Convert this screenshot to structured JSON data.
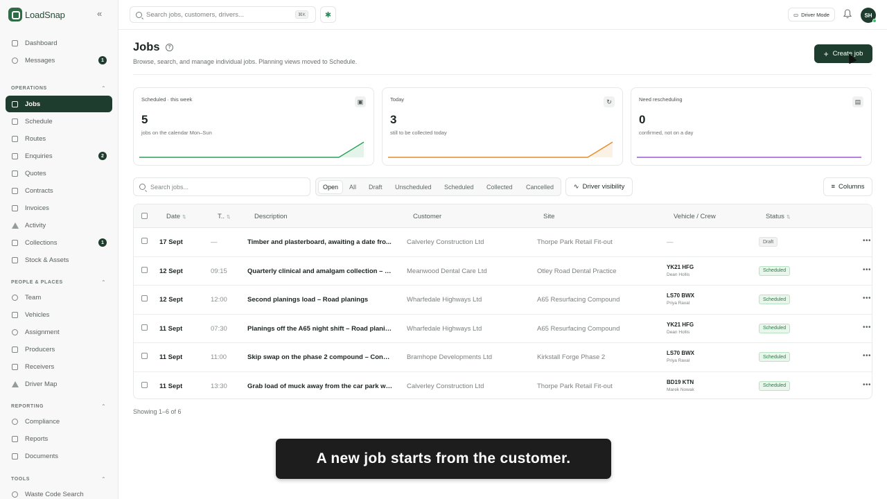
{
  "app": {
    "name": "LoadSnap",
    "collapse_glyph": "«"
  },
  "sidebar": {
    "top_items": [
      {
        "label": "Dashboard",
        "icon": "dashboard-icon"
      },
      {
        "label": "Messages",
        "icon": "message-icon",
        "badge": "1"
      }
    ],
    "sections": [
      {
        "title": "OPERATIONS",
        "items": [
          {
            "label": "Jobs",
            "icon": "clipboard-icon",
            "active": true
          },
          {
            "label": "Schedule",
            "icon": "calendar-icon"
          },
          {
            "label": "Routes",
            "icon": "route-icon"
          },
          {
            "label": "Enquiries",
            "icon": "document-icon",
            "badge": "2"
          },
          {
            "label": "Quotes",
            "icon": "quote-icon"
          },
          {
            "label": "Contracts",
            "icon": "contract-icon"
          },
          {
            "label": "Invoices",
            "icon": "invoice-icon"
          },
          {
            "label": "Activity",
            "icon": "activity-icon"
          },
          {
            "label": "Collections",
            "icon": "collections-icon",
            "badge": "1"
          },
          {
            "label": "Stock & Assets",
            "icon": "box-icon"
          }
        ]
      },
      {
        "title": "PEOPLE & PLACES",
        "items": [
          {
            "label": "Team",
            "icon": "team-icon"
          },
          {
            "label": "Vehicles",
            "icon": "truck-icon"
          },
          {
            "label": "Assignment",
            "icon": "link-icon"
          },
          {
            "label": "Producers",
            "icon": "producer-icon"
          },
          {
            "label": "Receivers",
            "icon": "download-icon"
          },
          {
            "label": "Driver Map",
            "icon": "navigation-icon"
          }
        ]
      },
      {
        "title": "REPORTING",
        "items": [
          {
            "label": "Compliance",
            "icon": "shield-icon"
          },
          {
            "label": "Reports",
            "icon": "bar-chart-icon"
          },
          {
            "label": "Documents",
            "icon": "file-icon"
          }
        ]
      },
      {
        "title": "TOOLS",
        "items": [
          {
            "label": "Waste Code Search",
            "icon": "search-icon"
          }
        ]
      }
    ]
  },
  "topbar": {
    "search_placeholder": "Search jobs, customers, drivers...",
    "search_shortcut": "⌘K",
    "driver_mode_label": "Driver Mode",
    "avatar_initials": "SH"
  },
  "page": {
    "title": "Jobs",
    "help_glyph": "?",
    "subtitle": "Browse, search, and manage individual jobs. Planning views moved to Schedule.",
    "create_button": "Create job",
    "create_glyph": "+"
  },
  "cards": [
    {
      "label": "Scheduled · this week",
      "value": "5",
      "sub": "jobs on the calendar Mon–Sun",
      "color": "#27a157",
      "icon": "calendar-check-icon",
      "glyph": "▣",
      "trend": [
        0,
        0,
        0,
        0,
        0,
        0,
        0,
        0,
        0,
        1
      ]
    },
    {
      "label": "Today",
      "value": "3",
      "sub": "still to be collected today",
      "color": "#e8892b",
      "icon": "refresh-icon",
      "glyph": "↻",
      "trend": [
        0,
        0,
        0,
        0,
        0,
        0,
        0,
        0,
        0,
        1
      ]
    },
    {
      "label": "Need rescheduling",
      "value": "0",
      "sub": "confirmed, not on a day",
      "color": "#9b59d0",
      "icon": "calendar-icon",
      "glyph": "▤",
      "trend": [
        0,
        0,
        0,
        0,
        0,
        0,
        0,
        0,
        0,
        0
      ]
    }
  ],
  "filters": {
    "search_placeholder": "Search jobs...",
    "tabs": [
      "Open",
      "All",
      "Draft",
      "Unscheduled",
      "Scheduled",
      "Collected",
      "Cancelled"
    ],
    "active_tab": "Open",
    "driver_visibility": "Driver visibility",
    "columns": "Columns"
  },
  "table": {
    "headers": [
      "Date",
      "T..",
      "Description",
      "Customer",
      "Site",
      "Vehicle / Crew",
      "Status"
    ],
    "rows": [
      {
        "date": "17 Sept",
        "time": "—",
        "description": "Timber and plasterboard, awaiting a date fro...",
        "customer": "Calverley Construction Ltd",
        "site": "Thorpe Park Retail Fit-out",
        "vehicle": "",
        "crew": "",
        "vehicle_empty": "—",
        "status": "Draft"
      },
      {
        "date": "12 Sept",
        "time": "09:15",
        "description": "Quarterly clinical and amalgam collection – Cl...",
        "customer": "Meanwood Dental Care Ltd",
        "site": "Otley Road Dental Practice",
        "vehicle": "YK21 HFG",
        "crew": "Dean Hollis",
        "status": "Scheduled"
      },
      {
        "date": "12 Sept",
        "time": "12:00",
        "description": "Second planings load – Road planings",
        "customer": "Wharfedale Highways Ltd",
        "site": "A65 Resurfacing Compound",
        "vehicle": "LS70 BWX",
        "crew": "Priya Raval",
        "status": "Scheduled"
      },
      {
        "date": "11 Sept",
        "time": "07:30",
        "description": "Planings off the A65 night shift – Road planings",
        "customer": "Wharfedale Highways Ltd",
        "site": "A65 Resurfacing Compound",
        "vehicle": "YK21 HFG",
        "crew": "Dean Hollis",
        "status": "Scheduled"
      },
      {
        "date": "11 Sept",
        "time": "11:00",
        "description": "Skip swap on the phase 2 compound – Concr...",
        "customer": "Bramhope Developments Ltd",
        "site": "Kirkstall Forge Phase 2",
        "vehicle": "LS70 BWX",
        "crew": "Priya Raval",
        "status": "Scheduled"
      },
      {
        "date": "11 Sept",
        "time": "13:30",
        "description": "Grab load of muck away from the car park wo...",
        "customer": "Calverley Construction Ltd",
        "site": "Thorpe Park Retail Fit-out",
        "vehicle": "BD19 KTN",
        "crew": "Marek Nowak",
        "status": "Scheduled"
      }
    ],
    "more_glyph": "•••",
    "footer": "Showing 1–6 of 6"
  },
  "caption": "A new job starts from the customer."
}
